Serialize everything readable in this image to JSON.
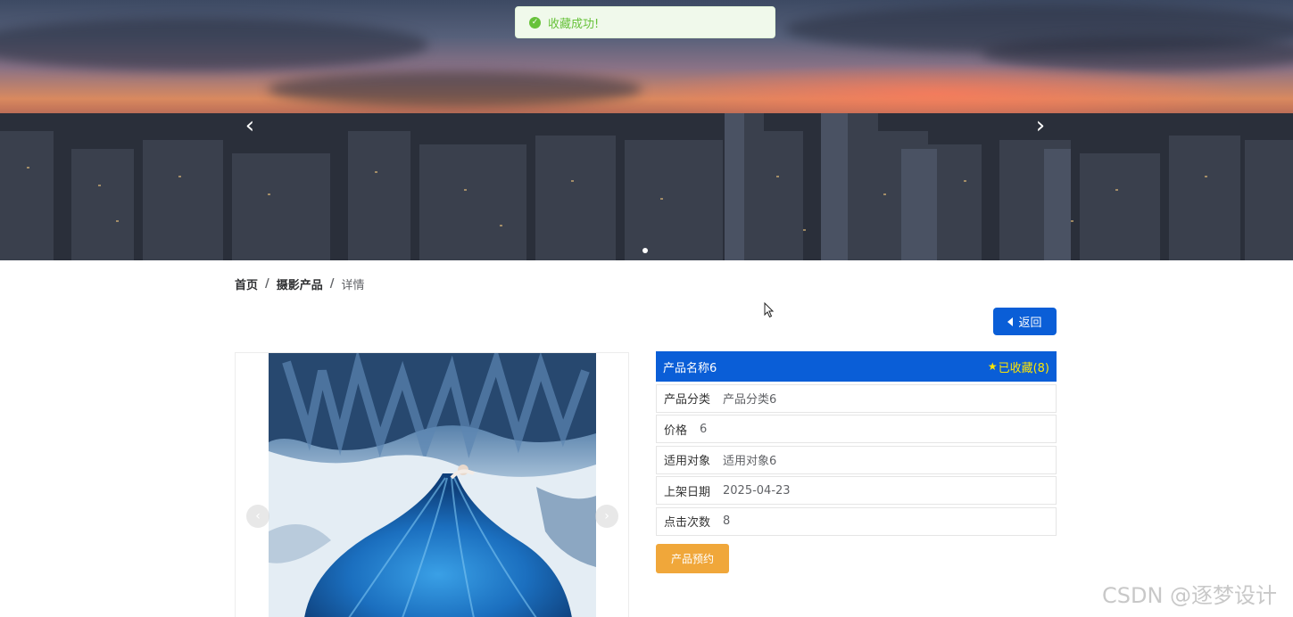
{
  "toast": {
    "message": "收藏成功!",
    "icon": "check-circle-icon",
    "color": "#67c23a"
  },
  "banner": {
    "prev_icon": "chevron-left-icon",
    "next_icon": "chevron-right-icon",
    "slide_count": 1,
    "active_slide": 1
  },
  "breadcrumb": {
    "home": "首页",
    "section": "摄影产品",
    "current": "详情",
    "separator": "/"
  },
  "back_button": {
    "label": "返回",
    "icon": "caret-left-icon",
    "color": "#0a5ed7"
  },
  "product": {
    "name": "产品名称6",
    "favorite_label": "已收藏(8)",
    "favorite_icon": "star-icon",
    "fields": [
      {
        "label": "产品分类",
        "value": "产品分类6"
      },
      {
        "label": "价格",
        "value": "6"
      },
      {
        "label": "适用对象",
        "value": "适用对象6"
      },
      {
        "label": "上架日期",
        "value": "2025-04-23"
      },
      {
        "label": "点击次数",
        "value": "8"
      }
    ],
    "book_button": "产品预约",
    "book_color": "#f0a73a",
    "header_color": "#0a5ed7"
  },
  "watermark": "CSDN @逐梦设计"
}
